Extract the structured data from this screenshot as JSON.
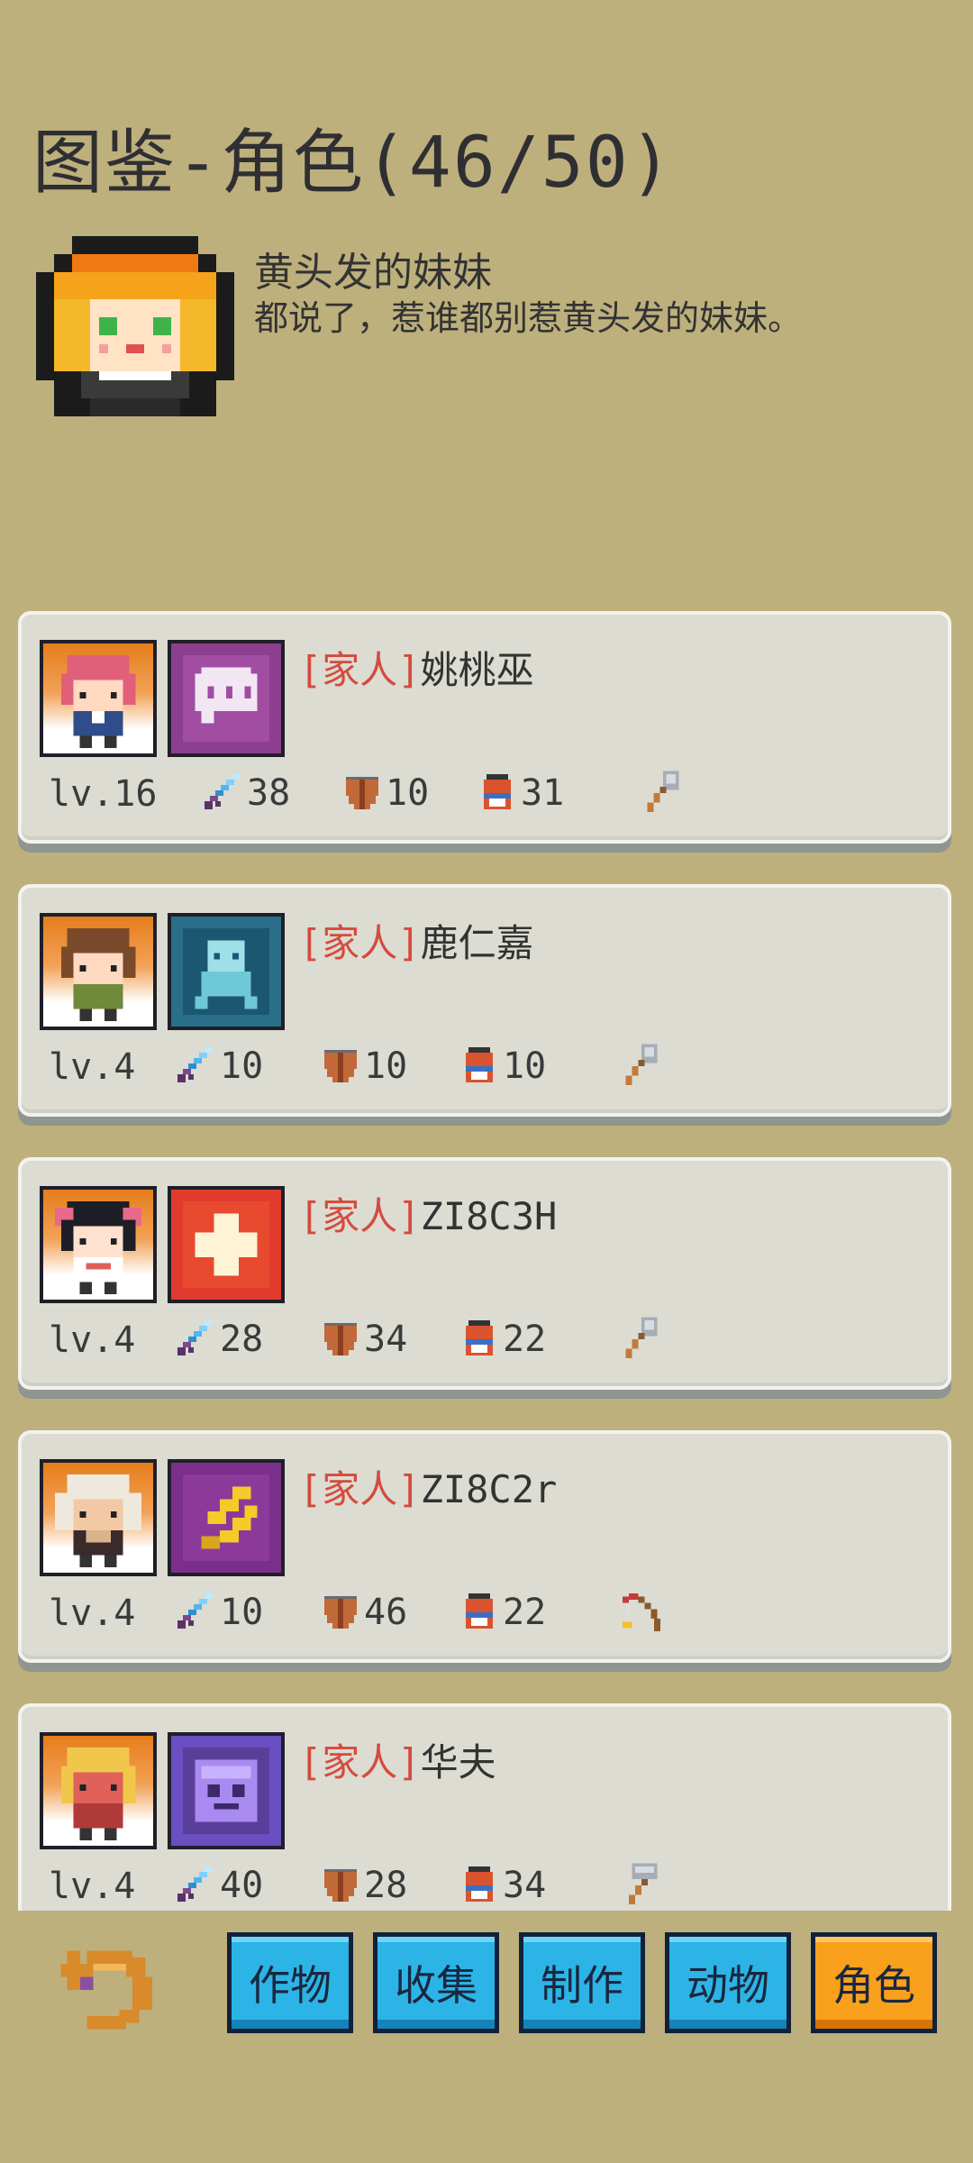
{
  "header": {
    "title": "图鉴-角色(46/50)"
  },
  "featured": {
    "name": "黄头发的妹妹",
    "description": "都说了，惹谁都别惹黄头发的妹妹。"
  },
  "tag_prefix": "[家人]",
  "characters": [
    {
      "name": "姚桃巫",
      "level": "lv.16",
      "attack": "38",
      "defense": "10",
      "bag": "31",
      "tool": "axe-icon",
      "skill": "chat-bubble-icon",
      "skill_color": "#8c3f8e"
    },
    {
      "name": "鹿仁嘉",
      "level": "lv.4",
      "attack": "10",
      "defense": "10",
      "bag": "10",
      "tool": "axe-icon",
      "skill": "ghost-skill-icon",
      "skill_color": "#2a6f8a"
    },
    {
      "name": "ZI8C3H",
      "level": "lv.4",
      "attack": "28",
      "defense": "34",
      "bag": "22",
      "tool": "axe-icon",
      "skill": "heal-cross-icon",
      "skill_color": "#e23b2e"
    },
    {
      "name": "ZI8C2r",
      "level": "lv.4",
      "attack": "10",
      "defense": "46",
      "bag": "22",
      "tool": "fishing-rod-icon",
      "skill": "lightning-claw-icon",
      "skill_color": "#7a2f8a"
    },
    {
      "name": "华夫",
      "level": "lv.4",
      "attack": "40",
      "defense": "28",
      "bag": "34",
      "tool": "hammer-icon",
      "skill": "slime-face-icon",
      "skill_color": "#6a4fc2"
    }
  ],
  "tabs": [
    {
      "label": "作物",
      "active": false
    },
    {
      "label": "收集",
      "active": false
    },
    {
      "label": "制作",
      "active": false
    },
    {
      "label": "动物",
      "active": false
    },
    {
      "label": "角色",
      "active": true
    }
  ],
  "colors": {
    "background": "#bdb07c",
    "tab_blue": "#2bb4e5",
    "tab_active": "#f9a01c",
    "tag_red": "#d44b3e"
  }
}
